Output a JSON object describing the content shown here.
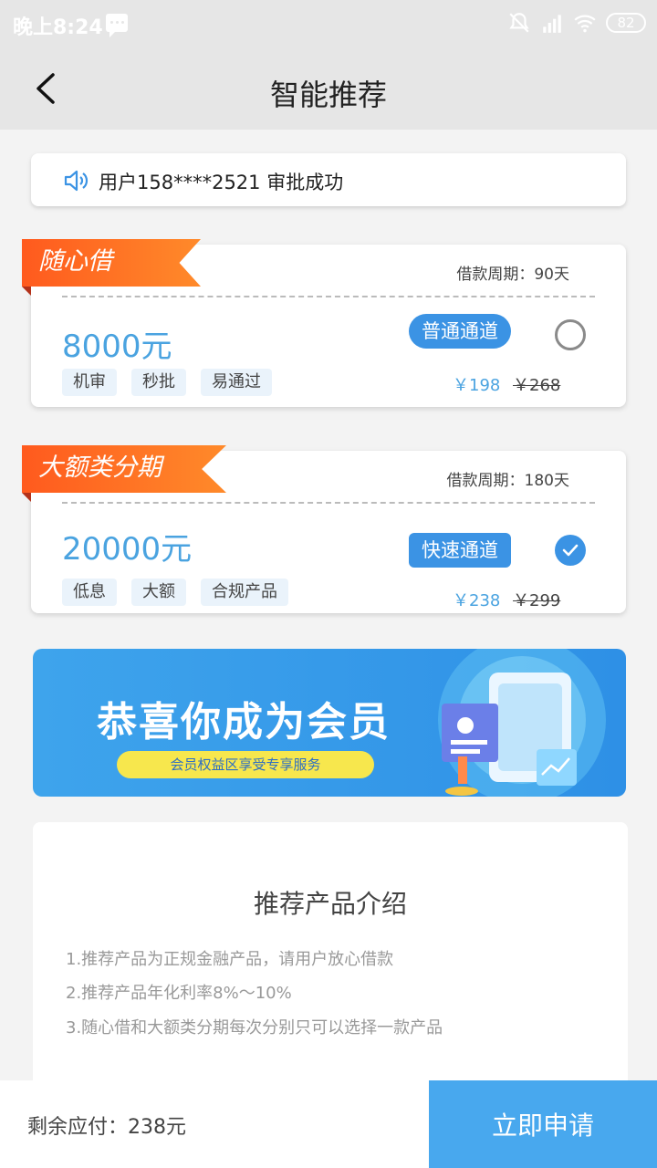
{
  "status_bar": {
    "time": "晚上8:24",
    "battery": "82"
  },
  "header": {
    "title": "智能推荐"
  },
  "notice": {
    "text": "用户158****2521 审批成功"
  },
  "products": [
    {
      "name": "随心借",
      "period": "借款周期：90天",
      "amount": "8000元",
      "tags": [
        "机审",
        "秒批",
        "易通过"
      ],
      "channel": "普通通道",
      "price": "￥198",
      "original_price": "￥268",
      "selected": false
    },
    {
      "name": "大额类分期",
      "period": "借款周期：180天",
      "amount": "20000元",
      "tags": [
        "低息",
        "大额",
        "合规产品"
      ],
      "channel": "快速通道",
      "price": "￥238",
      "original_price": "￥299",
      "selected": true
    }
  ],
  "banner": {
    "title": "恭喜你成为会员",
    "subtitle": "会员权益区享受专享服务"
  },
  "intro": {
    "title": "推荐产品介绍",
    "lines": [
      "1.推荐产品为正规金融产品，请用户放心借款",
      "2.推荐产品年化利率8%～10%",
      "3.随心借和大额类分期每次分别只可以选择一款产品"
    ]
  },
  "footer": {
    "remaining": "剩余应付：238元",
    "apply_label": "立即申请"
  }
}
